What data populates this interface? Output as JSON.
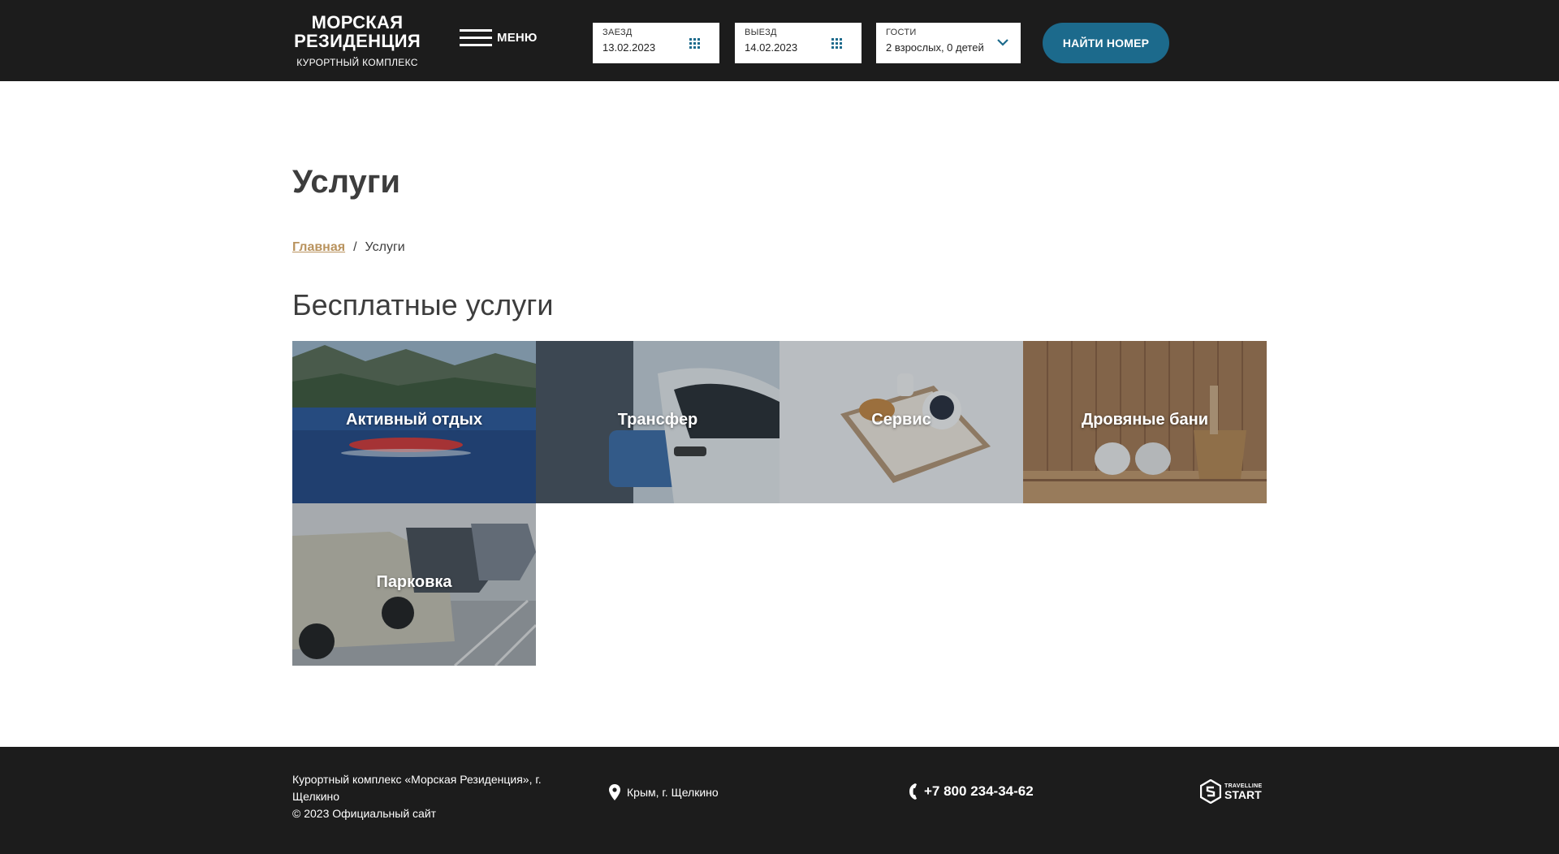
{
  "header": {
    "logo_line1": "МОРСКАЯ",
    "logo_line2": "РЕЗИДЕНЦИЯ",
    "logo_sub": "КУРОРТНЫЙ КОМПЛЕКС",
    "menu_label": "МЕНЮ",
    "checkin": {
      "label": "ЗАЕЗД",
      "value": "13.02.2023",
      "icon": "calendar-icon"
    },
    "checkout": {
      "label": "ВЫЕЗД",
      "value": "14.02.2023",
      "icon": "calendar-icon"
    },
    "guests": {
      "label": "ГОСТИ",
      "value": "2 взрослых, 0 детей",
      "icon": "chevron-down-icon"
    },
    "find_button": "НАЙТИ НОМЕР",
    "accent_color": "#1c6a8c"
  },
  "main": {
    "title": "Услуги",
    "breadcrumb": {
      "home": "Главная",
      "separator": "/",
      "current": "Услуги"
    },
    "section_title": "Бесплатные услуги",
    "services": [
      {
        "label": "Активный отдых"
      },
      {
        "label": "Трансфер"
      },
      {
        "label": "Сервис"
      },
      {
        "label": "Дровяные бани"
      },
      {
        "label": "Парковка"
      }
    ]
  },
  "footer": {
    "company": "Курортный комплекс «Морская Резиденция», г. Щелкино",
    "copyright": "© 2023 Официальный сайт",
    "address": "Крым, г. Щелкино",
    "phone": "+7 800 234-34-62",
    "partner_small": "TRAVELLINE",
    "partner_big": "START"
  }
}
